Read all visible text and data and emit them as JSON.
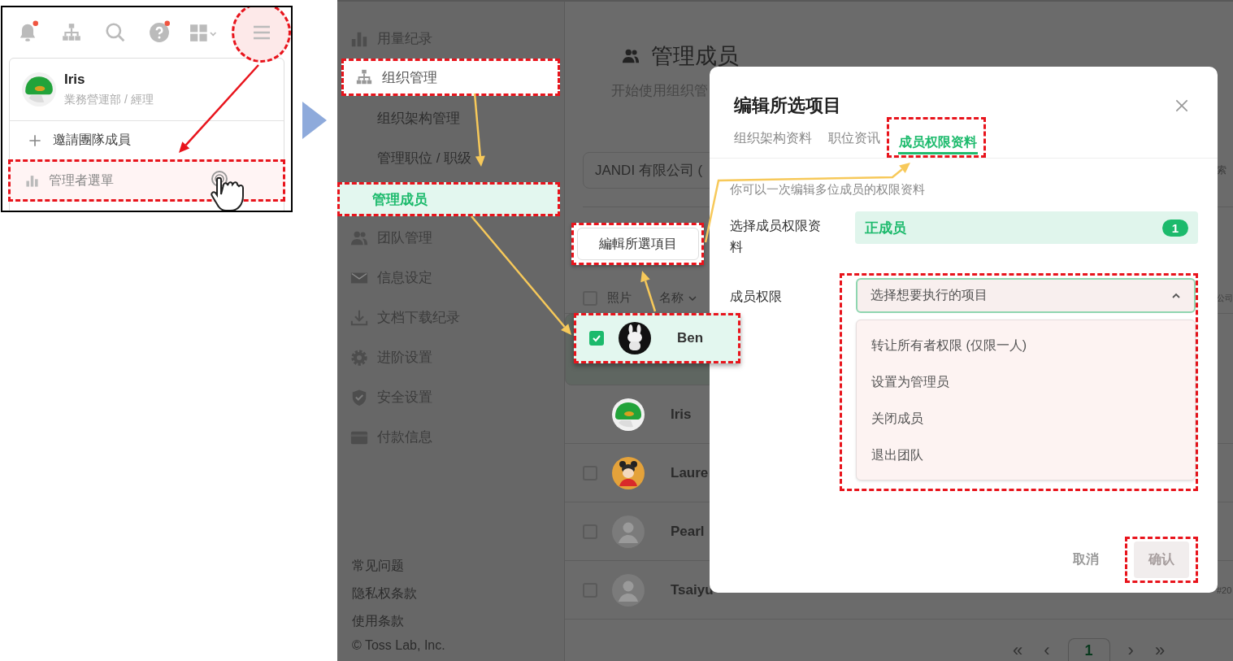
{
  "guide_panel": {
    "toolbar": [
      {
        "kind": "bell",
        "badge": true
      },
      {
        "kind": "org",
        "badge": false
      },
      {
        "kind": "search",
        "badge": false
      },
      {
        "kind": "help",
        "badge": true
      },
      {
        "kind": "apps",
        "badge": false
      },
      {
        "kind": "menu",
        "badge": false
      }
    ],
    "profile": {
      "name": "Iris",
      "department": "業務營運部 / 經理"
    },
    "menu_items": [
      {
        "label": "邀請團隊成員",
        "selected": false
      },
      {
        "label": "管理者選單",
        "selected": true
      }
    ]
  },
  "sidebar": {
    "items": [
      {
        "label": "用量纪录",
        "selected": false
      },
      {
        "label": "组织管理",
        "selected": false,
        "expanded": true,
        "children": [
          {
            "label": "组织架构管理",
            "selected": false
          },
          {
            "label": "管理职位 / 职级",
            "selected": false
          },
          {
            "label": "管理成员",
            "selected": true
          }
        ]
      },
      {
        "label": "团队管理",
        "selected": false
      },
      {
        "label": "信息设定",
        "selected": false
      },
      {
        "label": "文档下载纪录",
        "selected": false
      },
      {
        "label": "进阶设置",
        "selected": false
      },
      {
        "label": "安全设置",
        "selected": false
      },
      {
        "label": "付款信息",
        "selected": false
      }
    ],
    "footer_links": [
      "常见问题",
      "隐私权条款",
      "使用条款"
    ],
    "copyright": "© Toss Lab, Inc."
  },
  "main": {
    "title": "管理成员",
    "subtitle": "开始使用组织管",
    "org_select": "JANDI 有限公司 (",
    "search_fragment": "索",
    "edit_button": "編輯所選項目",
    "select_all_checked": false,
    "columns": [
      "照片",
      "名称",
      "公司"
    ],
    "rows": [
      {
        "name": "Ben",
        "checked": true,
        "selected": true
      },
      {
        "name": "Iris",
        "selected": false
      },
      {
        "name": "Laure",
        "checked": false,
        "selected": false
      },
      {
        "name": "Pearl",
        "checked": false,
        "selected": false
      },
      {
        "name": "Tsaiyu",
        "checked": false,
        "selected": false,
        "column_3": "#20"
      }
    ],
    "pagination": [
      {
        "label": "«",
        "selected": false
      },
      {
        "label": "‹",
        "selected": false
      },
      {
        "label": "1",
        "selected": true
      },
      {
        "label": "›",
        "selected": false
      },
      {
        "label": "»",
        "selected": false
      }
    ]
  },
  "modal": {
    "title": "编辑所选项目",
    "tabs": [
      {
        "label": "组织架构资料",
        "selected": false
      },
      {
        "label": "职位资讯",
        "selected": false
      },
      {
        "label": "成员权限资料",
        "selected": true
      }
    ],
    "hint": "你可以一次编辑多位成员的权限资料",
    "fields": [
      {
        "kind": "chip",
        "label": "选择成员权限资料",
        "value": "正成员",
        "count": "1"
      },
      {
        "kind": "dropdown",
        "label": "成员权限",
        "placeholder": "选择想要执行的项目",
        "expanded": true,
        "options": [
          "转让所有者权限 (仅限一人)",
          "设置为管理员",
          "关闭成员",
          "退出团队"
        ]
      }
    ],
    "buttons": [
      {
        "kind": "text",
        "label": "取消",
        "disabled": false
      },
      {
        "kind": "primary",
        "label": "确认",
        "disabled": true
      }
    ]
  }
}
